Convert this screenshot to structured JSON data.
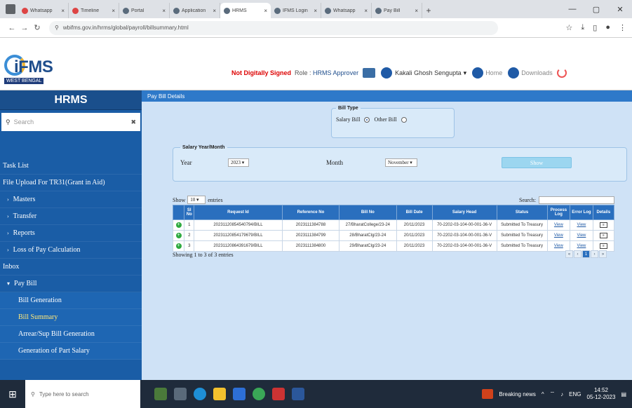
{
  "browser": {
    "tabs": [
      {
        "label": "Whatsapp",
        "fav": "red"
      },
      {
        "label": "Timeline",
        "fav": "red"
      },
      {
        "label": "Portal",
        "fav": ""
      },
      {
        "label": "Application",
        "fav": ""
      },
      {
        "label": "HRMS",
        "fav": "",
        "active": true
      },
      {
        "label": "IFMS Login",
        "fav": ""
      },
      {
        "label": "Whatsapp",
        "fav": ""
      },
      {
        "label": "Pay Bill",
        "fav": ""
      }
    ],
    "url": "wbifms.gov.in/hrms/global/payroll/billsummary.html",
    "window_controls": [
      "—",
      "▢",
      "✕"
    ]
  },
  "header": {
    "logo_text": "iFMS",
    "logo_sub": "WEST BENGAL",
    "not_signed": "Not Digitally Signed",
    "role_label": "Role :",
    "role_value": "HRMS Approver",
    "user_name": "Kakali Ghosh Sengupta",
    "home_label": "Home",
    "downloads_label": "Downloads"
  },
  "sidebar": {
    "title": "HRMS",
    "search_placeholder": "Search",
    "items": [
      {
        "label": "Task List",
        "level": 0
      },
      {
        "label": "File Upload For TR31(Grant in Aid)",
        "level": 0
      },
      {
        "label": "Masters",
        "level": 1
      },
      {
        "label": "Transfer",
        "level": 1
      },
      {
        "label": "Reports",
        "level": 1
      },
      {
        "label": "Loss of Pay Calculation",
        "level": 1
      },
      {
        "label": "Inbox",
        "level": 0
      },
      {
        "label": "Pay Bill",
        "level": 1,
        "open": true
      },
      {
        "label": "Bill Generation",
        "level": 2
      },
      {
        "label": "Bill Summary",
        "level": 2,
        "active": true
      },
      {
        "label": "Arrear/Sup Bill Generation",
        "level": 2
      },
      {
        "label": "Generation of Part Salary",
        "level": 2
      }
    ]
  },
  "main": {
    "bar_title": "Pay Bill Details",
    "bill_type": {
      "legend": "Bill Type",
      "option1": "Salary Bill",
      "option2": "Other Bill"
    },
    "salary": {
      "legend": "Salary Year/Month",
      "year_label": "Year",
      "year_value": "2023",
      "month_label": "Month",
      "month_value": "November",
      "show_button": "Show"
    },
    "table": {
      "show_label": "Show",
      "entries_value": "10",
      "entries_label": "entries",
      "search_label": "Search:",
      "headers": [
        "",
        "Sl No",
        "Request Id",
        "Reference No",
        "Bill No",
        "Bill Date",
        "Salary Head",
        "Status",
        "Process Log",
        "Error Log",
        "Details"
      ],
      "rows": [
        [
          "1",
          "20231120854540794/BILL",
          "2023111384788",
          "27/BharatCollege/23-24",
          "20/11/2023",
          "70-2202-03-104-00-001-36-V",
          "Submitted To Treasury",
          "View",
          "View"
        ],
        [
          "2",
          "20231120854179679/BILL",
          "2023111384799",
          "28/BharatClg/23-24",
          "20/11/2023",
          "70-2202-03-104-00-001-36-V",
          "Submitted To Treasury",
          "View",
          "View"
        ],
        [
          "3",
          "20231120864391679/BILL",
          "2023111384800",
          "29/BharatClg/23-24",
          "20/11/2023",
          "70-2202-03-104-00-001-36-V",
          "Submitted To Treasury",
          "View",
          "View"
        ]
      ],
      "showing": "Showing 1 to 3 of 3 entries",
      "pager": [
        "«",
        "‹",
        "1",
        "›",
        "»"
      ]
    }
  },
  "taskbar": {
    "search_placeholder": "Type here to search",
    "news": "Breaking news",
    "lang": "ENG",
    "time": "14:52",
    "date": "05-12-2023"
  }
}
